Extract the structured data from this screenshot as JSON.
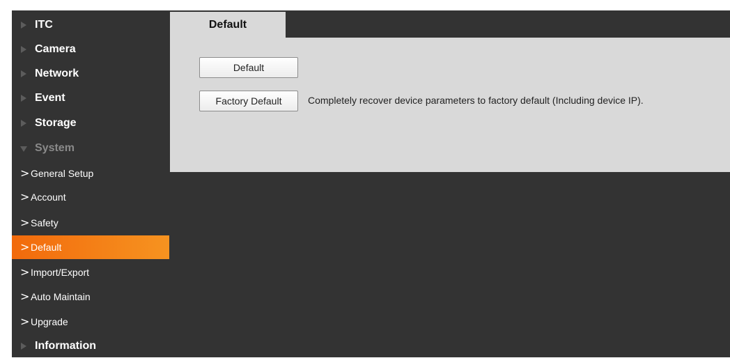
{
  "sidebar": {
    "items": [
      {
        "label": "ITC"
      },
      {
        "label": "Camera"
      },
      {
        "label": "Network"
      },
      {
        "label": "Event"
      },
      {
        "label": "Storage"
      },
      {
        "label": "System"
      }
    ],
    "system_sub": [
      {
        "label": "General Setup"
      },
      {
        "label": "Account"
      },
      {
        "label": "Safety"
      },
      {
        "label": "Default"
      },
      {
        "label": "Import/Export"
      },
      {
        "label": "Auto Maintain"
      },
      {
        "label": "Upgrade"
      }
    ],
    "after": [
      {
        "label": "Information"
      }
    ],
    "chevron_glyph": ">",
    "active_gradient": [
      "#f26a0c",
      "#f69320"
    ]
  },
  "tab": {
    "label": "Default"
  },
  "panel": {
    "default_button": "Default",
    "factory_button": "Factory Default",
    "factory_description": "Completely recover device parameters to factory default (Including device IP)."
  },
  "colors": {
    "background": "#333333",
    "panel": "#d9d9d9",
    "accent": "#f69320"
  }
}
